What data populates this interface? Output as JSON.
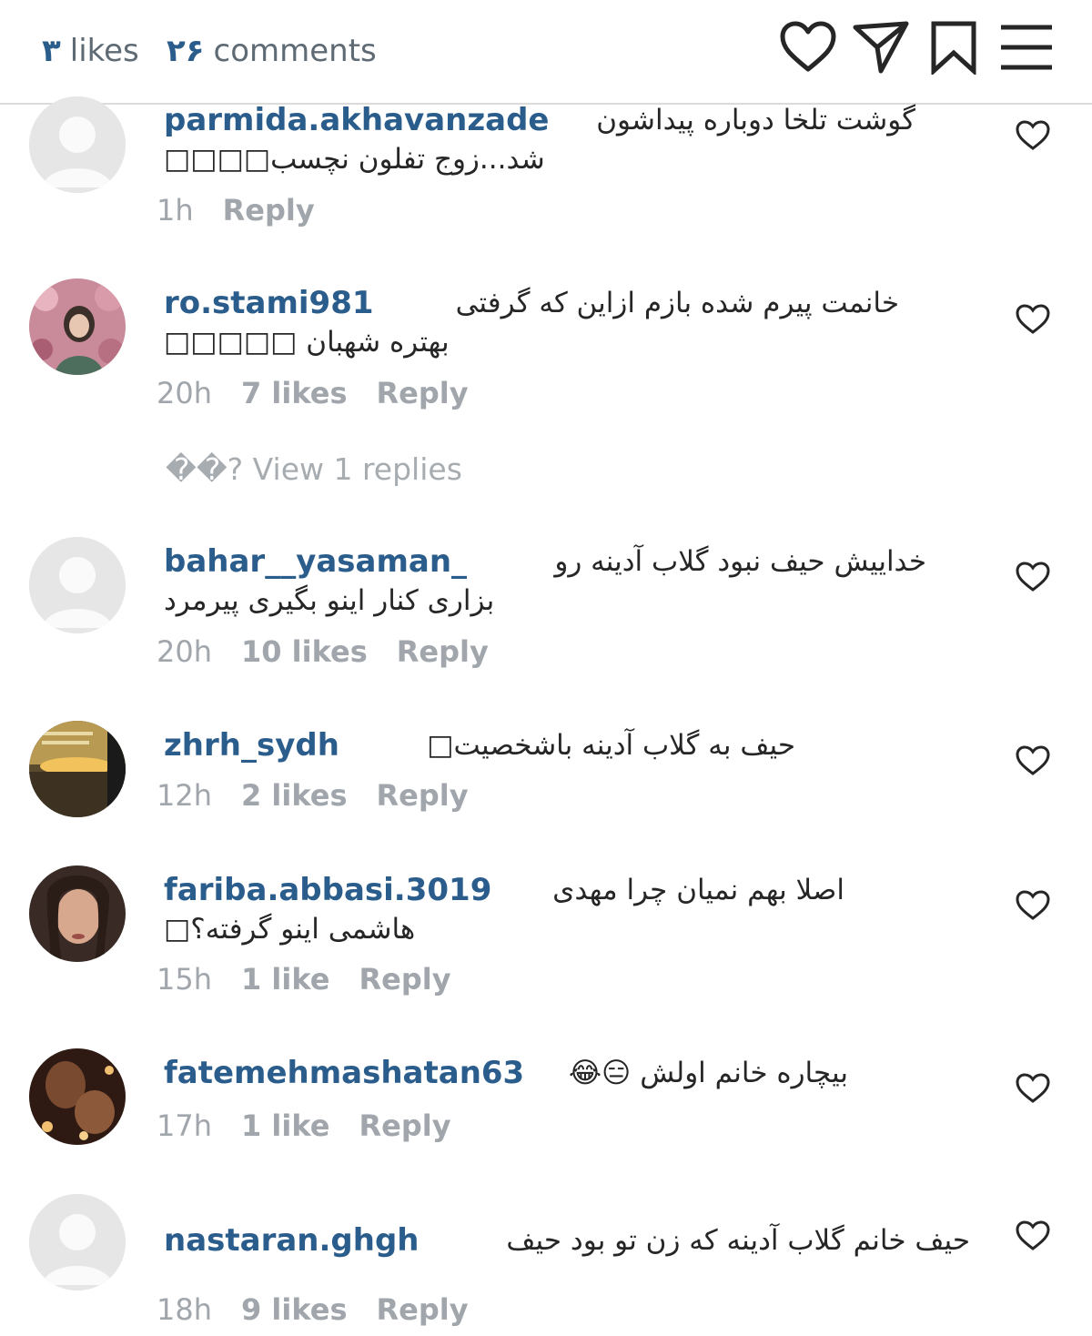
{
  "header": {
    "likes_count": "۳",
    "likes_label": "likes",
    "comments_count": "۲۶",
    "comments_label": "comments",
    "icons": [
      "heart-icon",
      "send-icon",
      "bookmark-icon",
      "menu-icon"
    ]
  },
  "comments": [
    {
      "username": "parmida.akhavanzade",
      "text_line1": "گوشت تلخا دوباره پیداشون",
      "text_line2": "شد...زوج تفلون نچسب□□□□",
      "time": "1h",
      "likes": "",
      "reply": "Reply",
      "avatar": "default"
    },
    {
      "username": "ro.stami981",
      "text_line1": "خانمت پیرم شده بازم ازاین که گرفتی",
      "text_line2": "بهتره شهبان □□□□□",
      "time": "20h",
      "likes": "7 likes",
      "reply": "Reply",
      "avatar": "photo-pink"
    },
    {
      "username": "bahar__yasaman_",
      "text_line1": "خداییش حیف نبود گلاب آدینه رو",
      "text_line2": "بزاری کنار اینو بگیری پیرمرد",
      "time": "20h",
      "likes": "10 likes",
      "reply": "Reply",
      "avatar": "default"
    },
    {
      "username": "zhrh_sydh",
      "text_line1": "حیف به گلاب آدینه باشخصیت□",
      "text_line2": "",
      "time": "12h",
      "likes": "2 likes",
      "reply": "Reply",
      "avatar": "photo-sunset"
    },
    {
      "username": "fariba.abbasi.3019",
      "text_line1": "اصلا بهم نمیان چرا مهدی",
      "text_line2": "هاشمی اینو گرفته؟□",
      "time": "15h",
      "likes": "1 like",
      "reply": "Reply",
      "avatar": "photo-woman"
    },
    {
      "username": "fatemehmashatan63",
      "text_line1": "بیچاره خانم اولش 😑😂",
      "text_line2": "",
      "time": "17h",
      "likes": "1 like",
      "reply": "Reply",
      "avatar": "photo-dark"
    },
    {
      "username": "nastaran.ghgh",
      "text_line1": "حیف خانم گلاب آدینه که زن تو بود حیف",
      "text_line2": "",
      "time": "18h",
      "likes": "9 likes",
      "reply": "Reply",
      "avatar": "default"
    }
  ],
  "view_replies": "��? View 1 replies",
  "colors": {
    "username": "#2b5d8c",
    "meta": "#a0a6ab",
    "divider": "#dbdbdb"
  }
}
